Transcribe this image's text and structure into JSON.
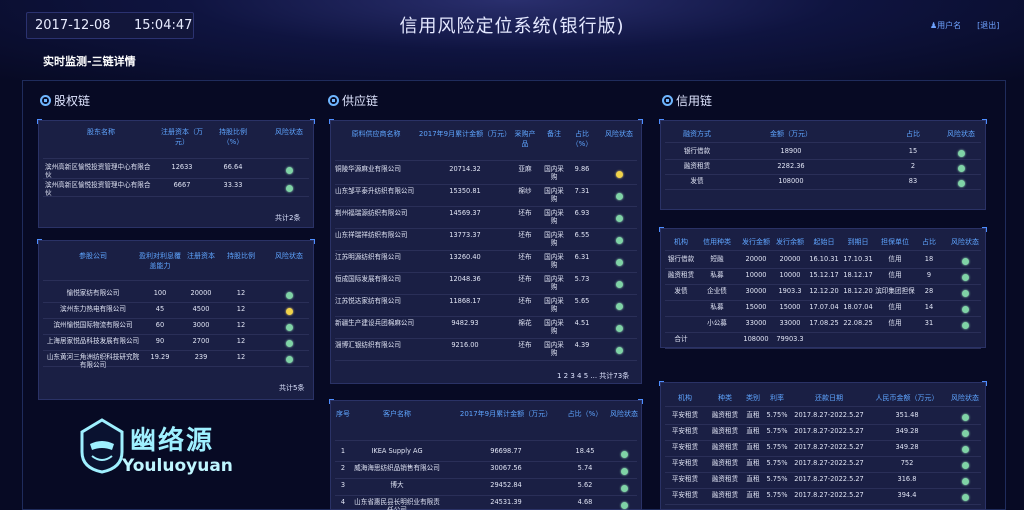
{
  "header": {
    "date": "2017-12-08",
    "time": "15:04:47",
    "title": "信用风险定位系统(银行版)",
    "user": "用户名",
    "logout": "[退出]",
    "breadcrumb": "实时监测-三链详情"
  },
  "sections": {
    "equity": "股权链",
    "supply": "供应链",
    "credit": "信用链"
  },
  "equity1": {
    "headers": [
      "股东名称",
      "注册资本（万元）",
      "持股比例（%）",
      "风险状态"
    ],
    "rows": [
      [
        "滨州高新区愉悦投资管理中心有限合伙",
        "12633",
        "66.64",
        "g"
      ],
      [
        "滨州高新区愉悦投资管理中心有限合伙",
        "6667",
        "33.33",
        "g"
      ]
    ],
    "footer": "共计2条"
  },
  "equity2": {
    "headers": [
      "参股公司",
      "盈利对利息覆盖能力",
      "注册资本",
      "持股比例",
      "风险状态"
    ],
    "rows": [
      [
        "愉悦家纺有限公司",
        "100",
        "20000",
        "12",
        "g"
      ],
      [
        "滨州东力热电有限公司",
        "45",
        "4500",
        "12",
        "y"
      ],
      [
        "滨州愉悦国际物流有限公司",
        "60",
        "3000",
        "12",
        "g"
      ],
      [
        "上海居家悦品科技发展有限公司",
        "90",
        "2700",
        "12",
        "g"
      ],
      [
        "山东黄河三角洲纺织科技研究院有限公司",
        "19.29",
        "239",
        "12",
        "g"
      ]
    ],
    "footer": "共计5条"
  },
  "supply1": {
    "headers": [
      "原料供应商名称",
      "2017年9月累计金额（万元）",
      "采购产品",
      "备注",
      "占比（%）",
      "风险状态"
    ],
    "rows": [
      [
        "铜陵华源麻业有限公司",
        "20714.32",
        "亚麻",
        "国内采购",
        "9.86",
        "y"
      ],
      [
        "山东邹平泰升纺织有限公司",
        "15350.81",
        "棉纱",
        "国内采购",
        "7.31",
        "g"
      ],
      [
        "荆州福瑞源纺织有限公司",
        "14569.37",
        "坯布",
        "国内采购",
        "6.93",
        "g"
      ],
      [
        "山东祥瑞祥纺织有限公司",
        "13773.37",
        "坯布",
        "国内采购",
        "6.55",
        "g"
      ],
      [
        "江苏明源纺织有限公司",
        "13260.40",
        "坯布",
        "国内采购",
        "6.31",
        "g"
      ],
      [
        "恒成国际发展有限公司",
        "12048.36",
        "坯布",
        "国内采购",
        "5.73",
        "g"
      ],
      [
        "江苏悦达家纺有限公司",
        "11868.17",
        "坯布",
        "国内采购",
        "5.65",
        "g"
      ],
      [
        "新疆生产建设兵团棉麻公司",
        "9482.93",
        "棉花",
        "国内采购",
        "4.51",
        "g"
      ],
      [
        "淄博汇银纺织有限公司",
        "9216.00",
        "坯布",
        "国内采购",
        "4.39",
        "g"
      ]
    ],
    "footer": "1 2 3 4 5 ... 共计73条"
  },
  "supply2": {
    "headers": [
      "序号",
      "客户名称",
      "2017年9月累计金额（万元）",
      "占比（%）",
      "风险状态"
    ],
    "rows": [
      [
        "1",
        "IKEA Supply AG",
        "96698.77",
        "18.45",
        "g"
      ],
      [
        "2",
        "威海海思纺织品销售有限公司",
        "30067.56",
        "5.74",
        "g"
      ],
      [
        "3",
        "博大",
        "29452.84",
        "5.62",
        "g"
      ],
      [
        "4",
        "山东省惠民县长明织业有限责任公司",
        "24531.39",
        "4.68",
        "g"
      ]
    ]
  },
  "credit1": {
    "headers": [
      "融资方式",
      "金额（万元）",
      "占比",
      "风险状态"
    ],
    "rows": [
      [
        "银行借款",
        "18900",
        "15",
        "g"
      ],
      [
        "融资租赁",
        "2282.36",
        "2",
        "g"
      ],
      [
        "发债",
        "108000",
        "83",
        "g"
      ]
    ]
  },
  "credit2": {
    "headers": [
      "机构",
      "信用种类",
      "发行金额",
      "发行余额",
      "起始日",
      "到期日",
      "担保单位",
      "占比",
      "风险状态"
    ],
    "rows": [
      [
        "银行借款",
        "短融",
        "20000",
        "20000",
        "16.10.31",
        "17.10.31",
        "信用",
        "18",
        "g"
      ],
      [
        "融资租赁",
        "私募",
        "10000",
        "10000",
        "15.12.17",
        "18.12.17",
        "信用",
        "9",
        "g"
      ],
      [
        "发债",
        "企业债",
        "30000",
        "1903.3",
        "12.12.20",
        "18.12.20",
        "滨印集团担保",
        "28",
        "g"
      ],
      [
        "",
        "私募",
        "15000",
        "15000",
        "17.07.04",
        "18.07.04",
        "信用",
        "14",
        "g"
      ],
      [
        "",
        "小公募",
        "33000",
        "33000",
        "17.08.25",
        "22.08.25",
        "信用",
        "31",
        "g"
      ],
      [
        "合计",
        "",
        "108000",
        "79903.3",
        "",
        "",
        "",
        "",
        ""
      ]
    ]
  },
  "credit3": {
    "headers": [
      "机构",
      "种类",
      "类别",
      "利率",
      "还款日期",
      "人民币金额（万元）",
      "风险状态"
    ],
    "rows": [
      [
        "平安租赁",
        "融资租赁",
        "直租",
        "5.75%",
        "2017.8.27-2022.5.27",
        "351.48",
        "g"
      ],
      [
        "平安租赁",
        "融资租赁",
        "直租",
        "5.75%",
        "2017.8.27-2022.5.27",
        "349.28",
        "g"
      ],
      [
        "平安租赁",
        "融资租赁",
        "直租",
        "5.75%",
        "2017.8.27-2022.5.27",
        "349.28",
        "g"
      ],
      [
        "平安租赁",
        "融资租赁",
        "直租",
        "5.75%",
        "2017.8.27-2022.5.27",
        "752",
        "g"
      ],
      [
        "平安租赁",
        "融资租赁",
        "直租",
        "5.75%",
        "2017.8.27-2022.5.27",
        "316.8",
        "g"
      ],
      [
        "平安租赁",
        "融资租赁",
        "直租",
        "5.75%",
        "2017.8.27-2022.5.27",
        "394.4",
        "g"
      ]
    ]
  },
  "watermark": {
    "cn": "幽络源",
    "en": "Youluoyuan"
  }
}
